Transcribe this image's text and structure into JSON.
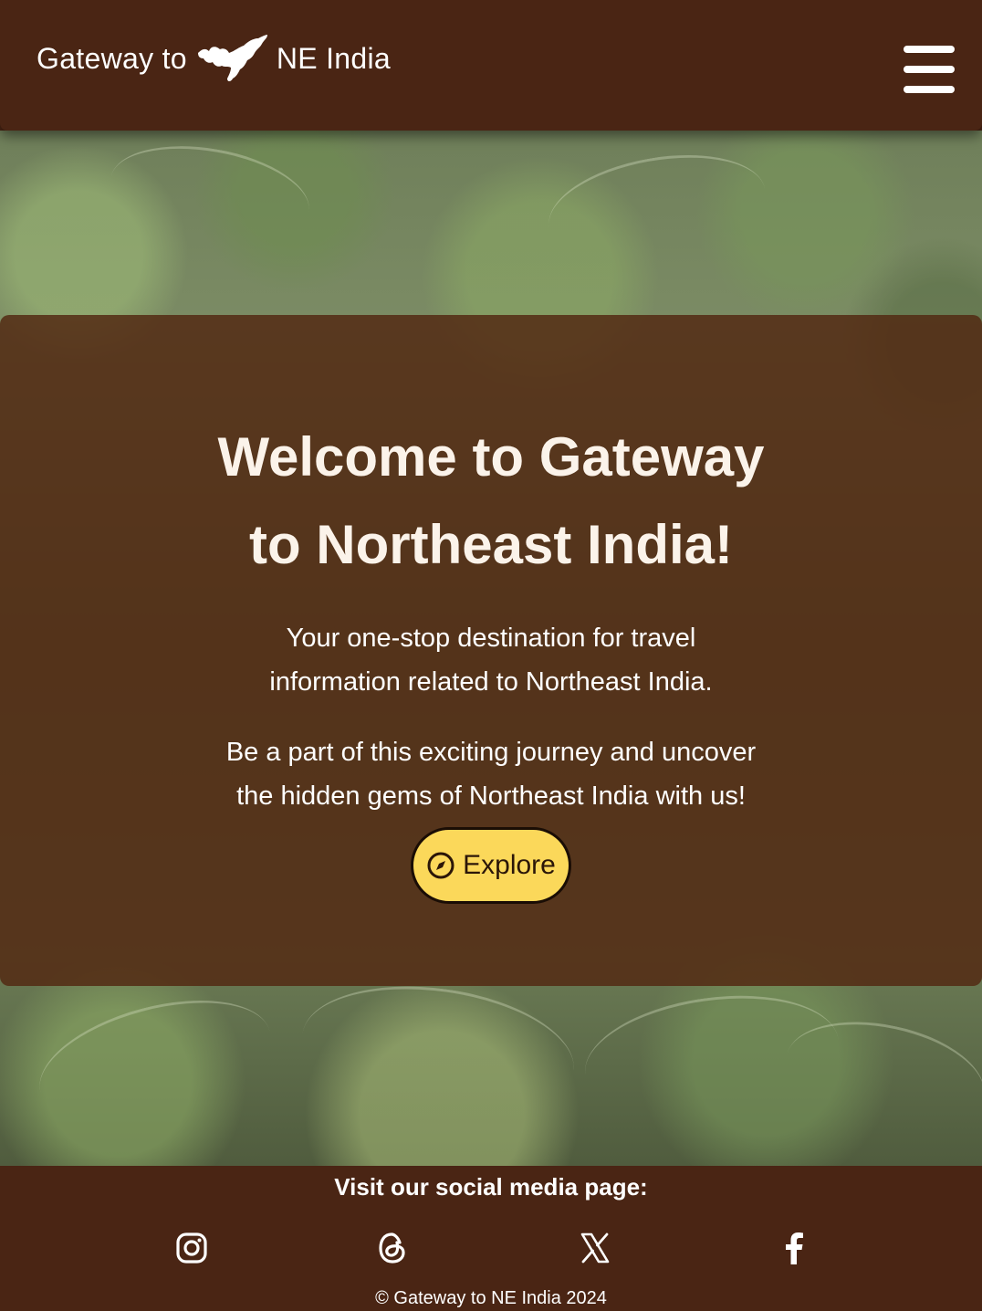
{
  "header": {
    "brand_prefix": "Gateway to",
    "brand_suffix": "NE India",
    "logo_icon": "northeast-india-map-icon",
    "menu_icon": "hamburger-menu-icon"
  },
  "hero": {
    "title_line1": "Welcome to Gateway",
    "title_line2": "to Northeast India!",
    "subtitle_line1": "Your one-stop destination for travel",
    "subtitle_line2": "information related to Northeast India.",
    "body_line1": "Be a part of this exciting journey and uncover",
    "body_line2": "the hidden gems of Northeast India with us!",
    "explore_label": "Explore",
    "explore_icon": "compass-icon"
  },
  "footer": {
    "visit_label": "Visit our social media page:",
    "social": [
      "instagram-icon",
      "threads-icon",
      "x-icon",
      "facebook-icon"
    ],
    "copyright": "© Gateway to NE India 2024"
  },
  "colors": {
    "header_bg": "#4a2514",
    "overlay": "#522812",
    "button": "#fbd85a",
    "text": "#ffffff"
  }
}
